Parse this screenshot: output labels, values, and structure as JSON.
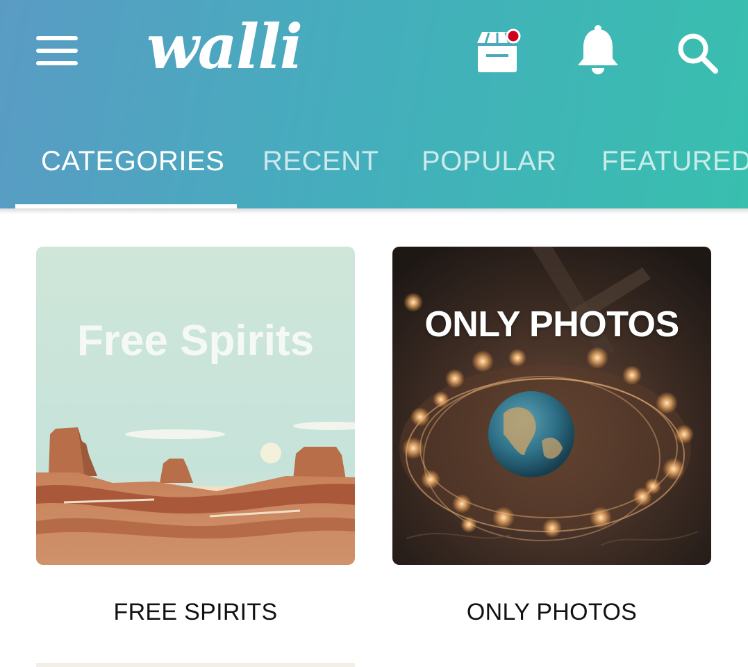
{
  "header": {
    "logo_text": "walli",
    "colors": {
      "gradient_start": "#5a9bc4",
      "gradient_end": "#38bfae",
      "notification_dot": "#d0021b"
    },
    "icons": [
      "menu-icon",
      "store-icon",
      "bell-icon",
      "search-icon"
    ]
  },
  "tabs": [
    {
      "label": "CATEGORIES",
      "active": true
    },
    {
      "label": "RECENT",
      "active": false
    },
    {
      "label": "POPULAR",
      "active": false
    },
    {
      "label": "FEATURED",
      "active": false
    }
  ],
  "categories": [
    {
      "image_title": "Free Spirits",
      "caption": "FREE SPIRITS"
    },
    {
      "image_title": "ONLY PHOTOS",
      "caption": "ONLY PHOTOS"
    }
  ]
}
